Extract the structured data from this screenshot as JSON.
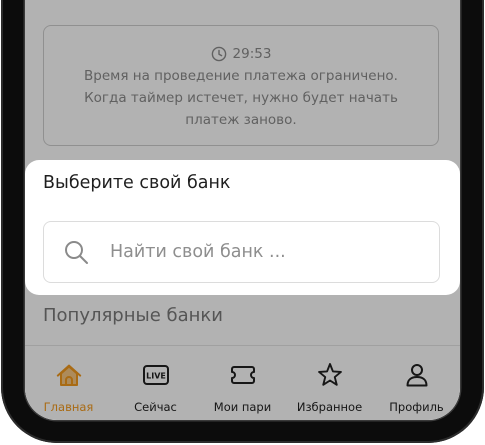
{
  "timer": {
    "icon": "clock-icon",
    "time": "29:53",
    "message_lines": [
      "Время на проведение платежа ограничено.",
      "Когда таймер истечет, нужно будет начать",
      "платеж заново."
    ]
  },
  "bank_select": {
    "title": "Выберите свой банк",
    "search": {
      "icon": "search-icon",
      "placeholder": "Найти свой банк ...",
      "value": ""
    }
  },
  "popular_banks": {
    "title": "Популярные банки"
  },
  "bottom_nav": {
    "items": [
      {
        "label": "Главная",
        "icon": "home-icon",
        "active": true
      },
      {
        "label": "Сейчас",
        "icon": "live-icon",
        "icon_text": "LIVE",
        "active": false
      },
      {
        "label": "Мои пари",
        "icon": "ticket-icon",
        "active": false
      },
      {
        "label": "Избранное",
        "icon": "star-icon",
        "active": false
      },
      {
        "label": "Профиль",
        "icon": "profile-icon",
        "active": false
      }
    ]
  },
  "colors": {
    "accent": "#f39a1e",
    "overlay": "rgba(0, 0, 0, 0.3)",
    "text_primary": "#1f1f1f",
    "text_muted": "#8b8b8b"
  }
}
